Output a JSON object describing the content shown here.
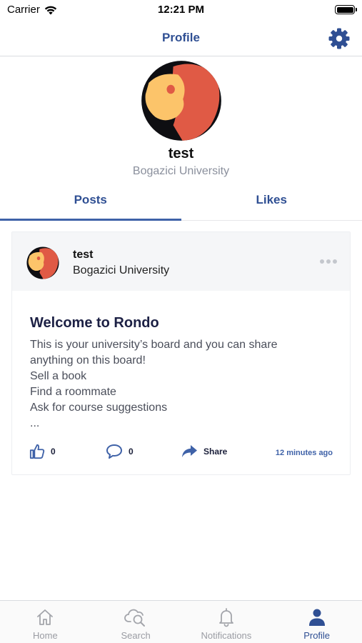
{
  "status": {
    "carrier": "Carrier",
    "time": "12:21 PM"
  },
  "nav": {
    "title": "Profile",
    "settings_icon": "gear-icon"
  },
  "profile": {
    "name": "test",
    "university": "Bogazici University"
  },
  "tabs": [
    {
      "label": "Posts",
      "active": true
    },
    {
      "label": "Likes",
      "active": false
    }
  ],
  "post": {
    "author": "test",
    "university": "Bogazici University",
    "title": "Welcome to Rondo",
    "body": [
      "This is your university’s board and you can share",
      "anything on this board!",
      "Sell a book",
      "Find a roommate",
      "Ask for course suggestions",
      "..."
    ],
    "likes": "0",
    "comments": "0",
    "share_label": "Share",
    "timestamp": "12 minutes ago"
  },
  "tab_bar": [
    {
      "label": "Home",
      "icon": "home-icon",
      "active": false
    },
    {
      "label": "Search",
      "icon": "search-cloud-icon",
      "active": false
    },
    {
      "label": "Notifications",
      "icon": "bell-icon",
      "active": false
    },
    {
      "label": "Profile",
      "icon": "person-icon",
      "active": true
    }
  ],
  "colors": {
    "accent": "#2f4f93",
    "avatar_red": "#e05a45",
    "avatar_yellow": "#fcc46a"
  }
}
